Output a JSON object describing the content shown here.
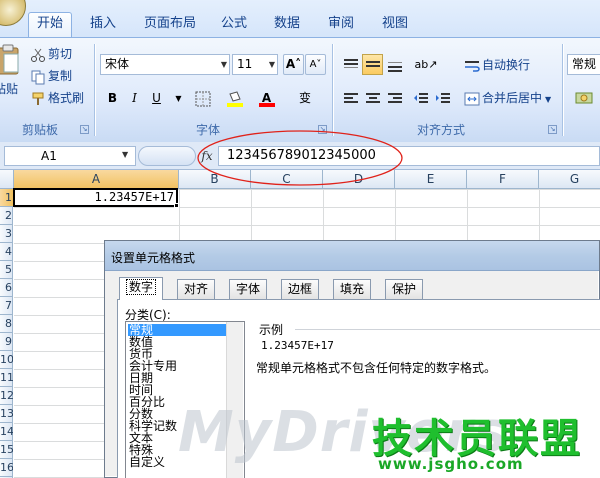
{
  "ribbon": {
    "tabs": [
      "开始",
      "插入",
      "页面布局",
      "公式",
      "数据",
      "审阅",
      "视图"
    ],
    "active_tab": "开始",
    "clipboard": {
      "paste": "粘贴",
      "cut": "剪切",
      "copy": "复制",
      "format_painter": "格式刷",
      "group_label": "剪贴板"
    },
    "font": {
      "font_name": "宋体",
      "font_size": "11",
      "bold": "B",
      "italic": "I",
      "underline": "U",
      "font_color_letter": "A",
      "phonetic": "变",
      "group_label": "字体"
    },
    "alignment": {
      "wrap_text": "自动换行",
      "merge_center": "合并后居中",
      "group_label": "对齐方式"
    },
    "number": {
      "format": "常规"
    }
  },
  "formula_bar": {
    "name_box": "A1",
    "fx": "fx",
    "content": "123456789012345000"
  },
  "sheet": {
    "columns": [
      "A",
      "B",
      "C",
      "D",
      "E",
      "F",
      "G"
    ],
    "rows": [
      "1",
      "2",
      "3",
      "4",
      "5",
      "6",
      "7",
      "8",
      "9",
      "10",
      "11",
      "12",
      "13",
      "14",
      "15",
      "16"
    ],
    "cell_a1": "1.23457E+17"
  },
  "dialog": {
    "title": "设置单元格格式",
    "tabs": [
      "数字",
      "对齐",
      "字体",
      "边框",
      "填充",
      "保护"
    ],
    "active_tab": "数字",
    "category_label": "分类(C):",
    "categories": [
      "常规",
      "数值",
      "货币",
      "会计专用",
      "日期",
      "时间",
      "百分比",
      "分数",
      "科学记数",
      "文本",
      "特殊",
      "自定义"
    ],
    "selected_category": "常规",
    "sample_label": "示例",
    "sample_value": "1.23457E+17",
    "description": "常规单元格格式不包含任何特定的数字格式。"
  },
  "watermark": {
    "latin": "MyDrivers",
    "cn": "技术员联盟",
    "url": "www.jsgho.com"
  }
}
